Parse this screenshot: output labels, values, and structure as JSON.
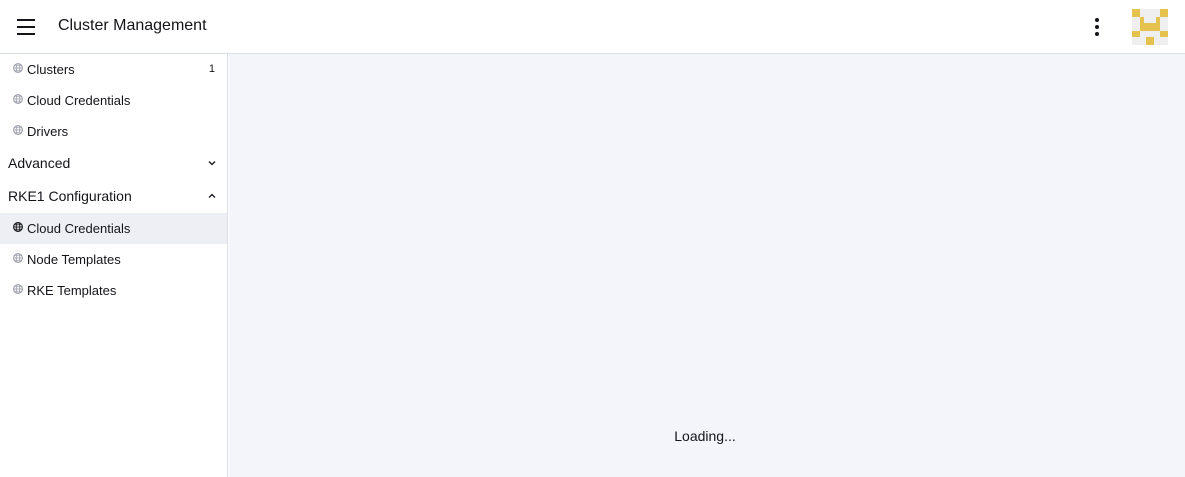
{
  "header": {
    "title": "Cluster Management",
    "menu_icon": "hamburger-menu-icon",
    "more_icon": "kebab-menu-icon",
    "avatar_icon": "user-avatar-identicon",
    "avatar_color": "#e5c24d"
  },
  "sidebar": {
    "items": [
      {
        "label": "Clusters",
        "count": "1",
        "icon": "globe-icon"
      },
      {
        "label": "Cloud Credentials",
        "icon": "globe-icon"
      },
      {
        "label": "Drivers",
        "icon": "globe-icon"
      }
    ],
    "groups": [
      {
        "label": "Advanced",
        "expanded": false,
        "chevron": "chevron-down-icon"
      },
      {
        "label": "RKE1 Configuration",
        "expanded": true,
        "chevron": "chevron-up-icon",
        "items": [
          {
            "label": "Cloud Credentials",
            "icon": "globe-icon",
            "active": true
          },
          {
            "label": "Node Templates",
            "icon": "globe-icon"
          },
          {
            "label": "RKE Templates",
            "icon": "globe-icon"
          }
        ]
      }
    ]
  },
  "main": {
    "status": "Loading...",
    "background": "#f4f5fa"
  },
  "colors": {
    "active_item_bg": "#eeeff4",
    "border": "#dcdee7"
  }
}
